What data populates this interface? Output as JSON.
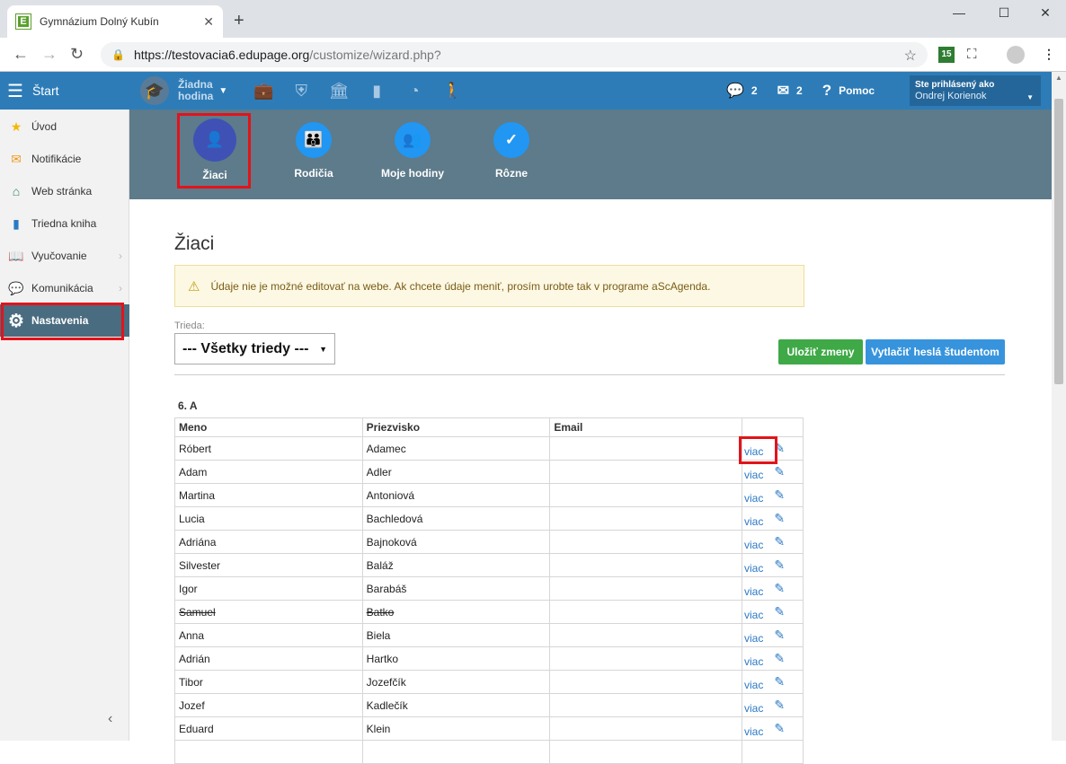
{
  "browser": {
    "tab_title": "Gymnázium Dolný Kubín",
    "favicon_letter": "E",
    "url_host": "https://testovacia6.edupage.org",
    "url_path": "/customize/wizard.php?",
    "ext_badge": "15"
  },
  "header": {
    "start_label": "Štart",
    "lesson_line1": "Žiadna",
    "lesson_line2": "hodina",
    "chat_count": "2",
    "mail_count": "2",
    "help_label": "Pomoc",
    "user_line1": "Ste prihlásený ako",
    "user_line2": "Ondrej Korienok"
  },
  "sidebar": {
    "items": [
      {
        "label": "Úvod",
        "icon": "star-icon"
      },
      {
        "label": "Notifikácie",
        "icon": "envelope-icon"
      },
      {
        "label": "Web stránka",
        "icon": "house-icon"
      },
      {
        "label": "Triedna kniha",
        "icon": "book-icon"
      },
      {
        "label": "Vyučovanie",
        "icon": "open-book-icon"
      },
      {
        "label": "Komunikácia",
        "icon": "chat-icon"
      },
      {
        "label": "Nastavenia",
        "icon": "gear-icon"
      }
    ]
  },
  "subnav": {
    "items": [
      {
        "label": "Žiaci",
        "icon": "person-icon"
      },
      {
        "label": "Rodičia",
        "icon": "parents-icon"
      },
      {
        "label": "Moje hodiny",
        "icon": "group-icon"
      },
      {
        "label": "Rôzne",
        "icon": "check-icon"
      }
    ]
  },
  "main": {
    "title": "Žiaci",
    "warning": "Údaje nie je možné editovať na webe. Ak chcete údaje meniť, prosím urobte tak v programe aScAgenda.",
    "class_label": "Trieda:",
    "class_value": "--- Všetky triedy ---",
    "save_button": "Uložiť zmeny",
    "print_button": "Vytlačiť heslá študentom",
    "group_label": "6. A",
    "columns": [
      "Meno",
      "Priezvisko",
      "Email",
      ""
    ],
    "more_label": "viac",
    "rows": [
      {
        "first": "Róbert",
        "last": "Adamec",
        "email": "",
        "strike": false
      },
      {
        "first": "Adam",
        "last": "Adler",
        "email": "",
        "strike": false
      },
      {
        "first": "Martina",
        "last": "Antoniová",
        "email": "",
        "strike": false
      },
      {
        "first": "Lucia",
        "last": "Bachledová",
        "email": "",
        "strike": false
      },
      {
        "first": "Adriána",
        "last": "Bajnoková",
        "email": "",
        "strike": false
      },
      {
        "first": "Silvester",
        "last": "Baláž",
        "email": "",
        "strike": false
      },
      {
        "first": "Igor",
        "last": "Barabáš",
        "email": "",
        "strike": false
      },
      {
        "first": "Samuel",
        "last": "Batko",
        "email": "",
        "strike": true
      },
      {
        "first": "Anna",
        "last": "Biela",
        "email": "",
        "strike": false
      },
      {
        "first": "Adrián",
        "last": "Hartko",
        "email": "",
        "strike": false
      },
      {
        "first": "Tibor",
        "last": "Jozefčík",
        "email": "",
        "strike": false
      },
      {
        "first": "Jozef",
        "last": "Kadlečík",
        "email": "",
        "strike": false
      },
      {
        "first": "Eduard",
        "last": "Klein",
        "email": "",
        "strike": false
      },
      {
        "first": "",
        "last": "",
        "email": "",
        "strike": false
      }
    ]
  },
  "colors": {
    "header_blue": "#2d7cb8",
    "subnav_bg": "#5d7b8a",
    "active_sidebar": "#4a6c80",
    "highlight_red": "#e3131a",
    "save_green": "#3fa947",
    "print_blue": "#3794dc"
  }
}
